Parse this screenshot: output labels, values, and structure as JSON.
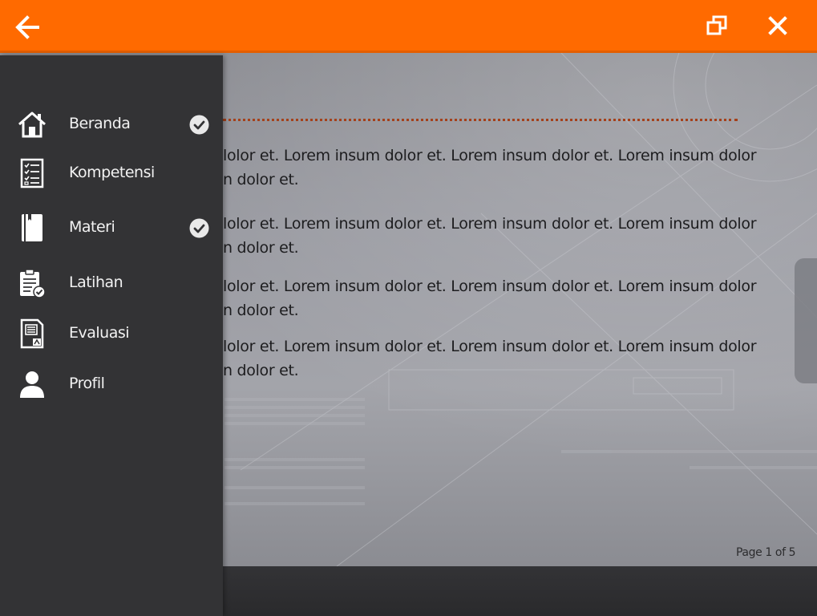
{
  "content": {
    "paragraphs": [
      {
        "line1": "lolor et. Lorem insum dolor et. Lorem insum dolor et. Lorem insum dolor",
        "line2": "n dolor et."
      },
      {
        "line1": "lolor et. Lorem insum dolor et. Lorem insum dolor et. Lorem insum dolor",
        "line2": "n dolor et."
      },
      {
        "line1": "lolor et. Lorem insum dolor et. Lorem insum dolor et. Lorem insum dolor",
        "line2": "n dolor et."
      },
      {
        "line1": "lolor et. Lorem insum dolor et. Lorem insum dolor et. Lorem insum dolor",
        "line2": "n dolor et."
      }
    ],
    "page_indicator": "Page 1 of 5"
  },
  "sidebar": {
    "items": [
      {
        "label": "Beranda",
        "icon": "home-icon",
        "checked": true
      },
      {
        "label": "Kompetensi",
        "icon": "checklist-icon",
        "checked": false
      },
      {
        "label": "Materi",
        "icon": "book-icon",
        "checked": true
      },
      {
        "label": "Latihan",
        "icon": "clipboard-check-icon",
        "checked": false
      },
      {
        "label": "Evaluasi",
        "icon": "document-edit-icon",
        "checked": false
      },
      {
        "label": "Profil",
        "icon": "user-icon",
        "checked": false
      }
    ]
  },
  "toolbar": {
    "back_icon": "arrow-left-icon",
    "restore_icon": "restore-window-icon",
    "close_icon": "close-icon"
  },
  "colors": {
    "accent": "#ff6a00",
    "sidebar_bg": "#333335",
    "rule": "#a4411b"
  }
}
